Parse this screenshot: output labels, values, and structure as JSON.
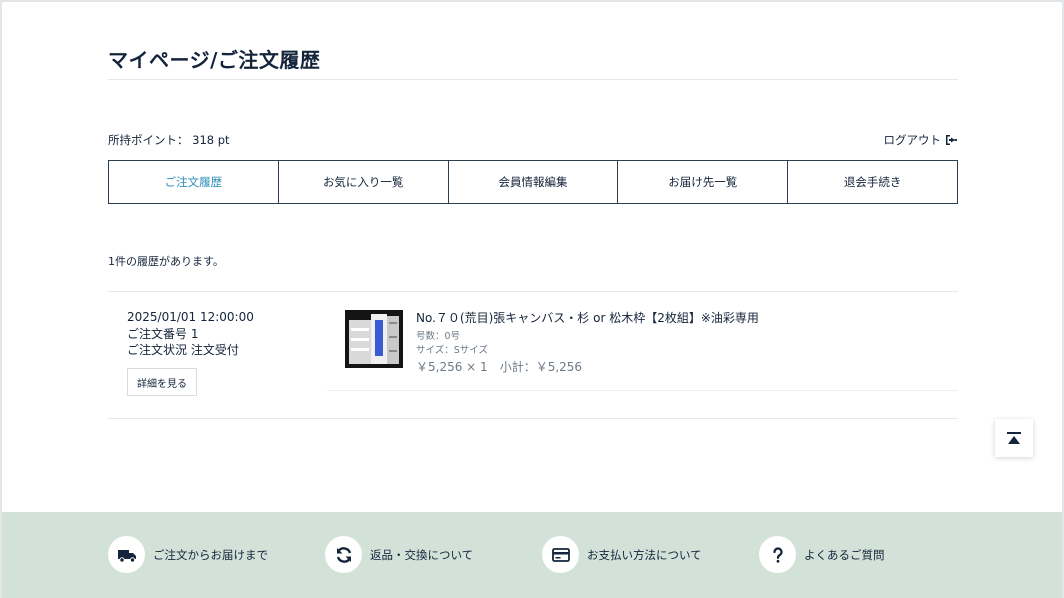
{
  "page": {
    "title": "マイページ/ご注文履歴"
  },
  "account": {
    "points_label": "所持ポイント： 318 pt",
    "logout_label": "ログアウト"
  },
  "tabs": [
    {
      "label": "ご注文履歴",
      "active": true
    },
    {
      "label": "お気に入り一覧",
      "active": false
    },
    {
      "label": "会員情報編集",
      "active": false
    },
    {
      "label": "お届け先一覧",
      "active": false
    },
    {
      "label": "退会手続き",
      "active": false
    }
  ],
  "history": {
    "count_text": "1件の履歴があります。",
    "orders": [
      {
        "datetime": "2025/01/01 12:00:00",
        "order_number": "ご注文番号 1",
        "status": "ご注文状況 注文受付",
        "detail_button": "詳細を見る",
        "items": [
          {
            "name": "No.７０(荒目)張キャンバス・杉 or 松木枠【2枚組】※油彩専用",
            "size_number": "号数：0号",
            "size": "サイズ：Sサイズ",
            "price": "￥5,256 × 1",
            "subtotal": "小計：￥5,256"
          }
        ]
      }
    ]
  },
  "footer": {
    "items": [
      {
        "label": "ご注文からお届けまで",
        "icon": "truck-icon"
      },
      {
        "label": "返品・交換について",
        "icon": "refresh-icon"
      },
      {
        "label": "お支払い方法について",
        "icon": "credit-card-icon"
      },
      {
        "label": "よくあるご質問",
        "icon": "question-icon"
      }
    ]
  },
  "colors": {
    "text": "#14243a",
    "accent": "#2a8fb8",
    "footer_bg": "#d3e2d9",
    "muted": "#6e7a86"
  }
}
